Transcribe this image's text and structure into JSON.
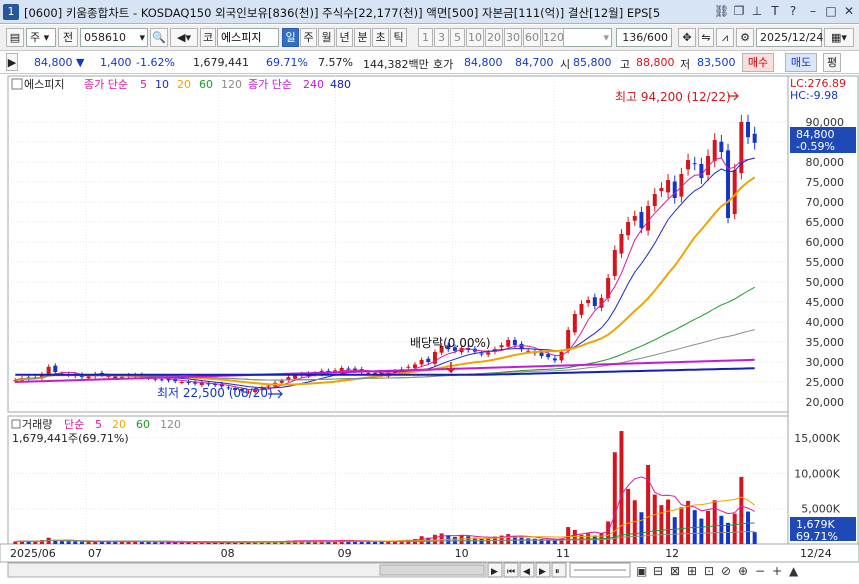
{
  "window": {
    "number": "1",
    "title": "[0600] 키움종합차트 - KOSDAQ150 외국인보유[836(천)] 주식수[22,177(천)] 액면[500] 자본금[111(억)] 결산[12월] EPS[5"
  },
  "toolbar": {
    "type_select": "주",
    "prev_label": "전",
    "code": "058610",
    "market_label": "코",
    "stock_name": "에스피지",
    "periods": [
      "일",
      "주",
      "월",
      "년",
      "분",
      "초",
      "틱"
    ],
    "selected_period": "일",
    "intervals": [
      "1",
      "3",
      "5",
      "10",
      "20",
      "30",
      "60",
      "120"
    ],
    "count": "136",
    "count_total": "/600",
    "date": "2025/12/24"
  },
  "quote": {
    "price": "84,800",
    "change": "1,400",
    "change_pct": "-1.62%",
    "volume": "1,679,441",
    "volume_ratio": "69.71%",
    "turnover": "7.57%",
    "amount": "144,382백만",
    "ask_label": "호가",
    "ask": "84,800",
    "bid": "84,700",
    "open_label": "시",
    "open": "85,800",
    "high_label": "고",
    "high": "88,800",
    "low_label": "저",
    "low": "83,500",
    "buy_label": "매수",
    "sell_label": "매도",
    "eval_label": "평"
  },
  "colors": {
    "up": "#d4151d",
    "down": "#1336c8",
    "ma5": "#e0199b",
    "ma10": "#1b2cc8",
    "ma20": "#f0a400",
    "ma60": "#1c9a2b",
    "ma120": "#8c8c8c",
    "ma240": "#c21ad6",
    "ma480": "#1220b8"
  },
  "legend_price": {
    "name": "에스피지",
    "ma_label": "종가 단순",
    "ma_periods": [
      "5",
      "10",
      "20",
      "60",
      "120"
    ],
    "ma_label2": "종가 단순",
    "ma_periods2": [
      "240",
      "480"
    ]
  },
  "legend_volume": {
    "name": "거래량",
    "ma_label": "단순",
    "ma_periods": [
      "5",
      "20",
      "60",
      "120"
    ],
    "current": "1,679,441주(69.71%)"
  },
  "annotations": {
    "lc": "LC:276.89",
    "hc": "HC:-9.98",
    "high_note": "최고 94,200 (12/22)",
    "low_note": "최저 22,500 (08/20)",
    "dividend_note": "배당락(0.00%)",
    "price_tag": "84,800",
    "price_tag_pct": "-0.59%",
    "vol_tag": "1,679K",
    "vol_tag_pct": "69.71%"
  },
  "chart_data": {
    "type": "candlestick",
    "price_axis_ticks": [
      "90,000",
      "85,000",
      "80,000",
      "75,000",
      "70,000",
      "65,000",
      "60,000",
      "55,000",
      "50,000",
      "45,000",
      "40,000",
      "35,000",
      "30,000",
      "25,000",
      "20,000"
    ],
    "price_ylim": [
      18000,
      97000
    ],
    "volume_axis_ticks": [
      "15,000K",
      "10,000K",
      "5,000K"
    ],
    "volume_ylim": [
      0,
      17000
    ],
    "x_labels": [
      "2025/06",
      "07",
      "08",
      "09",
      "10",
      "11",
      "12",
      "12/24"
    ],
    "closes": [
      25500,
      26000,
      25800,
      26200,
      27000,
      28800,
      27500,
      27000,
      26800,
      26500,
      26200,
      26400,
      27000,
      26800,
      26500,
      26000,
      26300,
      26600,
      26800,
      26200,
      26000,
      25800,
      25600,
      25400,
      25200,
      25000,
      24800,
      24600,
      24800,
      24400,
      24200,
      23900,
      23500,
      23000,
      22800,
      22600,
      23200,
      23600,
      24100,
      24800,
      25300,
      26200,
      26800,
      27000,
      26500,
      27200,
      27800,
      27400,
      27900,
      28500,
      28200,
      27800,
      27500,
      27300,
      27100,
      26800,
      27400,
      27700,
      28200,
      28800,
      29400,
      30500,
      30000,
      32500,
      34000,
      33200,
      32800,
      33500,
      33000,
      32600,
      32000,
      32400,
      33200,
      34200,
      35500,
      34200,
      33200,
      32800,
      32200,
      31500,
      31200,
      30400,
      32500,
      38000,
      42000,
      44500,
      45500,
      44000,
      46000,
      51000,
      58000,
      62000,
      65000,
      66500,
      63500,
      69000,
      72000,
      73500,
      75500,
      71000,
      77000,
      80500,
      79500,
      76000,
      81500,
      85500,
      82500,
      66000,
      78000,
      90000,
      86200,
      84800
    ],
    "volumes_k": [
      350,
      420,
      380,
      360,
      550,
      900,
      480,
      420,
      380,
      350,
      320,
      300,
      400,
      360,
      340,
      310,
      330,
      350,
      420,
      300,
      280,
      260,
      250,
      240,
      230,
      220,
      210,
      200,
      220,
      200,
      190,
      180,
      210,
      250,
      230,
      220,
      260,
      300,
      320,
      380,
      420,
      480,
      520,
      460,
      380,
      450,
      520,
      460,
      500,
      560,
      480,
      420,
      400,
      390,
      370,
      360,
      420,
      480,
      520,
      600,
      700,
      1100,
      900,
      1300,
      1500,
      1200,
      1000,
      1250,
      1100,
      900,
      800,
      850,
      1050,
      1200,
      1400,
      1100,
      900,
      800,
      750,
      700,
      650,
      600,
      800,
      2400,
      2000,
      1300,
      1500,
      1200,
      1500,
      3200,
      13000,
      16000,
      7800,
      6200,
      4500,
      11200,
      7000,
      5500,
      6300,
      3800,
      5200,
      6100,
      4800,
      3600,
      4700,
      6200,
      4000,
      3000,
      4300,
      9500,
      4600,
      1679
    ]
  }
}
